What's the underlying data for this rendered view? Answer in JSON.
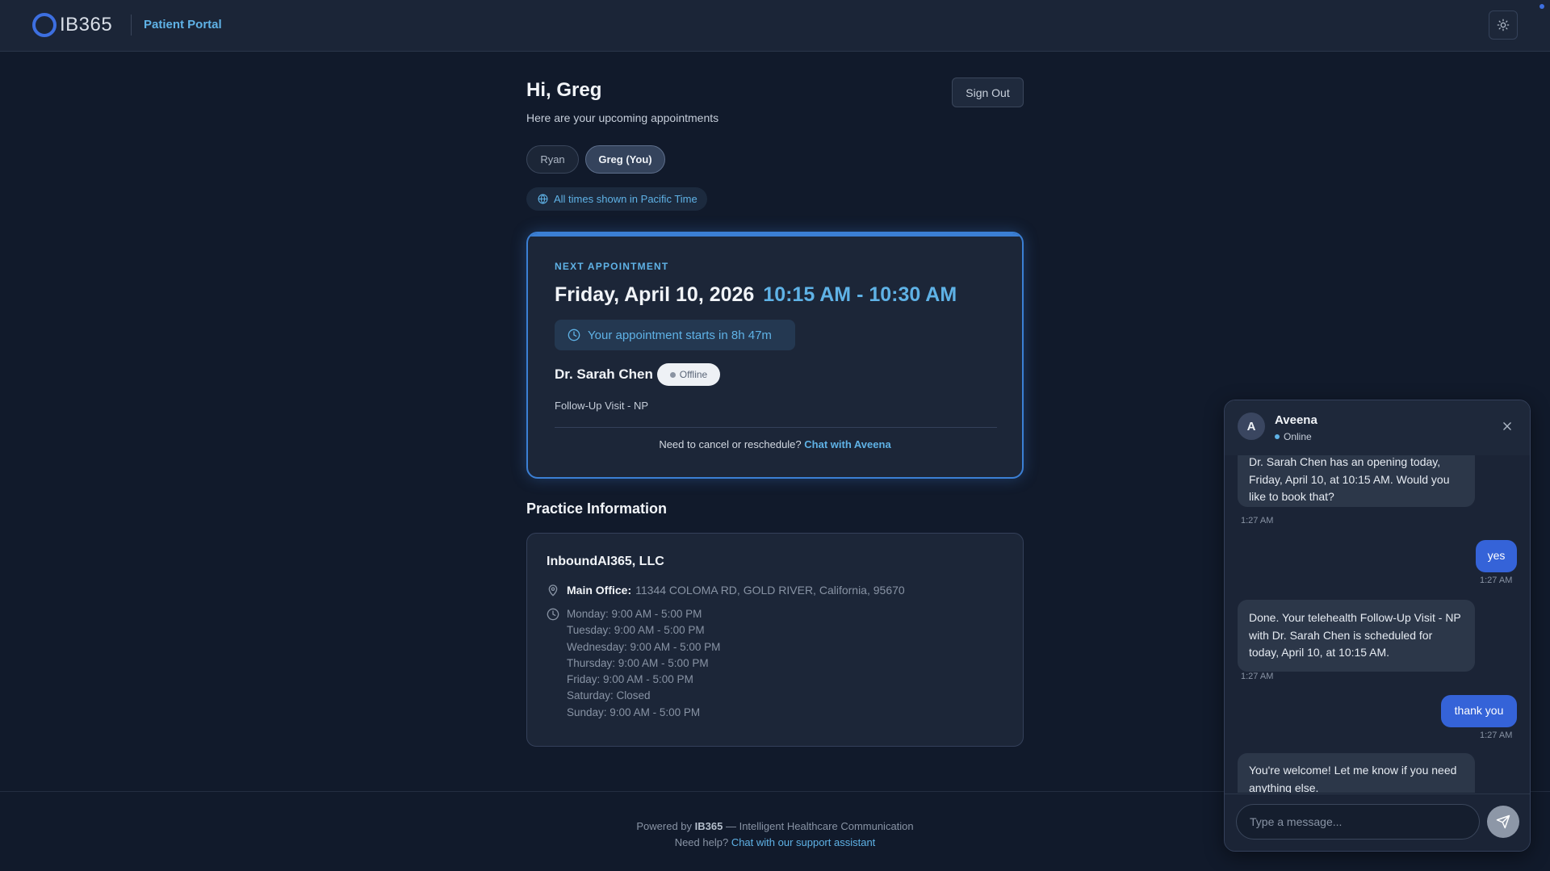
{
  "header": {
    "logo_text": "IB365",
    "portal_label": "Patient Portal"
  },
  "greeting": {
    "title": "Hi, Greg",
    "subtitle": "Here are your upcoming appointments",
    "sign_out": "Sign Out"
  },
  "patients": [
    {
      "label": "Ryan",
      "selected": false
    },
    {
      "label": "Greg (You)",
      "selected": true
    }
  ],
  "timezone_note": "All times shown in Pacific Time",
  "appointment": {
    "label": "NEXT APPOINTMENT",
    "date": "Friday, April 10, 2026",
    "time": "10:15 AM - 10:30 AM",
    "countdown": "Your appointment starts in 8h 47m",
    "doctor": "Dr. Sarah Chen",
    "doctor_status": "Offline",
    "visit_type": "Follow-Up Visit - NP",
    "cancel_prompt": "Need to cancel or reschedule?",
    "cancel_link": "Chat with Aveena"
  },
  "practice": {
    "section_title": "Practice Information",
    "name": "InboundAI365, LLC",
    "office_label": "Main Office:",
    "office_address": "11344 COLOMA RD, GOLD RIVER, California, 95670",
    "hours": [
      "Monday: 9:00 AM - 5:00 PM",
      "Tuesday: 9:00 AM - 5:00 PM",
      "Wednesday: 9:00 AM - 5:00 PM",
      "Thursday: 9:00 AM - 5:00 PM",
      "Friday: 9:00 AM - 5:00 PM",
      "Saturday: Closed",
      "Sunday: 9:00 AM - 5:00 PM"
    ]
  },
  "footer": {
    "powered_prefix": "Powered by",
    "powered_brand": "IB365",
    "powered_suffix": "— Intelligent Healthcare Communication",
    "help_prefix": "Need help?",
    "help_link": "Chat with our support assistant"
  },
  "chat": {
    "avatar_letter": "A",
    "agent_name": "Aveena",
    "agent_status": "Online",
    "messages": [
      {
        "from": "bot",
        "text": "Dr. Sarah Chen has an opening today, Friday, April 10, at 10:15 AM. Would you like to book that?",
        "time": "1:27 AM"
      },
      {
        "from": "user",
        "text": "yes",
        "time": "1:27 AM"
      },
      {
        "from": "bot",
        "text": "Done. Your telehealth Follow-Up Visit - NP with Dr. Sarah Chen is scheduled for today, April 10, at 10:15 AM.",
        "time": "1:27 AM"
      },
      {
        "from": "user",
        "text": "thank you",
        "time": "1:27 AM"
      },
      {
        "from": "bot",
        "text": "You're welcome! Let me know if you need anything else.",
        "time": ""
      }
    ],
    "input_placeholder": "Type a message..."
  },
  "colors": {
    "background": "#111a2b",
    "accent": "#5fb2e6",
    "brand": "#3d6fe0",
    "user_bubble": "#3563d8"
  },
  "icons": {
    "theme_toggle": "sun-icon",
    "timezone": "globe-icon",
    "countdown": "clock-icon",
    "office": "map-pin-icon",
    "hours": "clock-icon",
    "chat_close": "close-icon",
    "chat_send": "send-icon"
  }
}
